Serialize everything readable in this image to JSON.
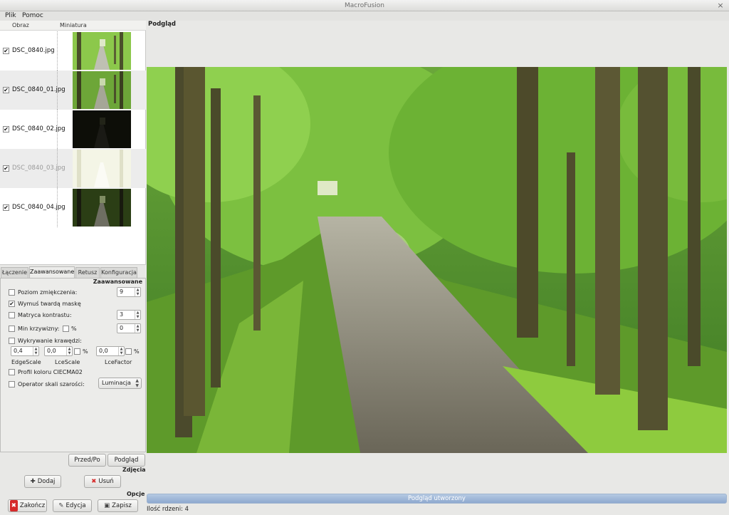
{
  "window": {
    "title": "MacroFusion",
    "close_glyph": "×"
  },
  "menu": [
    "Plik",
    "Pomoc"
  ],
  "file_list": {
    "columns": [
      "Obraz",
      "Miniatura"
    ],
    "rows": [
      {
        "name": "DSC_0840.jpg",
        "checked": true,
        "thumb": "normal"
      },
      {
        "name": "DSC_0840_01.jpg",
        "checked": true,
        "thumb": "normal"
      },
      {
        "name": "DSC_0840_02.jpg",
        "checked": true,
        "thumb": "dark"
      },
      {
        "name": "DSC_0840_03.jpg",
        "checked": true,
        "thumb": "bright"
      },
      {
        "name": "DSC_0840_04.jpg",
        "checked": true,
        "thumb": "medium-dark"
      }
    ]
  },
  "tabs": [
    "Łączenie",
    "Zaawansowane",
    "Retusz",
    "Konfiguracja"
  ],
  "active_tab": "Zaawansowane",
  "advanced": {
    "title": "Zaawansowane",
    "smoothing_label": "Poziom zmiękczenia:",
    "smoothing_value": "9",
    "hard_mask_label": "Wymuś twardą maskę",
    "contrast_window_label": "Matryca kontrastu:",
    "contrast_window_value": "3",
    "min_curvature_label": "Min krzywizny:",
    "percent": "%",
    "min_curvature_value": "0",
    "edge_detect_label": "Wykrywanie krawędzi:",
    "edge_scale_value": "0,4",
    "lce_scale_value": "0,0",
    "lce_factor_value": "0,0",
    "edge_scale_label": "EdgeScale",
    "lce_scale_label": "LceScale",
    "lce_factor_label": "LceFactor",
    "ciecam_label": "Profil koloru CIECMA02",
    "grayscale_label": "Operator skali szarości:",
    "grayscale_value": "Luminacja"
  },
  "buttons": {
    "before_after": "Przed/Po",
    "preview": "Podgląd",
    "add": "Dodaj",
    "remove": "Usuń",
    "quit": "Zakończ",
    "edit": "Edycja",
    "save": "Zapisz"
  },
  "sections": {
    "images": "Zdjęcia",
    "options": "Opcje"
  },
  "preview": {
    "label": "Podgląd"
  },
  "progress": {
    "text": "Podgląd utworzony",
    "fraction": 1.0
  },
  "status": {
    "text": "Ilość rdzeni: 4"
  },
  "colors": {
    "accent": "#8ea9cf",
    "remove_red": "#d62a2a",
    "add_dark": "#333333"
  }
}
